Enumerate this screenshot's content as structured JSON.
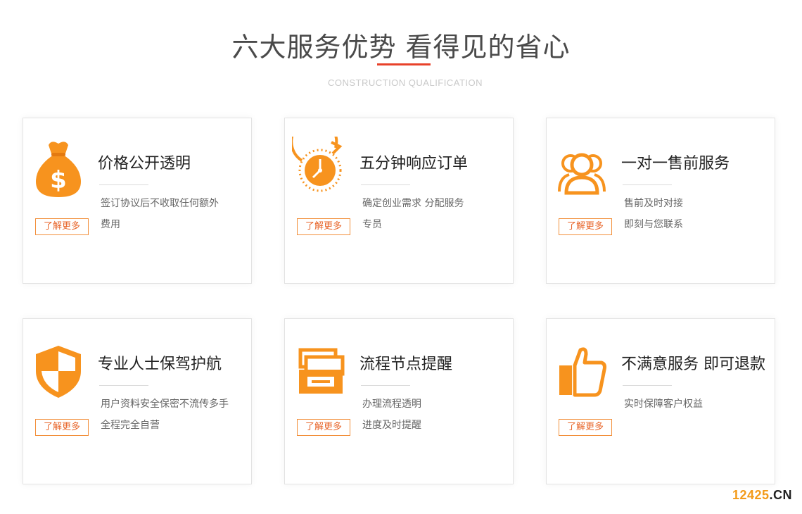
{
  "header": {
    "title": "六大服务优势 看得见的省心",
    "subtitle": "CONSTRUCTION QUALIFICATION"
  },
  "colors": {
    "accent": "#e8412a",
    "icon": "#f7931e",
    "button_border": "#f28f3a"
  },
  "cards": [
    {
      "icon": "money-bag-icon",
      "title": "价格公开透明",
      "desc_lines": [
        "签订协议后不收取任何额外",
        "费用"
      ],
      "button": "了解更多"
    },
    {
      "icon": "clock-icon",
      "title": "五分钟响应订单",
      "desc_lines": [
        "确定创业需求 分配服务",
        "专员"
      ],
      "button": "了解更多"
    },
    {
      "icon": "users-icon",
      "title": "一对一售前服务",
      "desc_lines": [
        "售前及时对接",
        "即刻与您联系"
      ],
      "button": "了解更多"
    },
    {
      "icon": "shield-icon",
      "title": "专业人士保驾护航",
      "desc_lines": [
        "用户资料安全保密不流传多手",
        "全程完全自营"
      ],
      "button": "了解更多"
    },
    {
      "icon": "folder-process-icon",
      "title": "流程节点提醒",
      "desc_lines": [
        "办理流程透明",
        "进度及时提醒"
      ],
      "button": "了解更多"
    },
    {
      "icon": "thumbs-up-icon",
      "title": "不满意服务 即可退款",
      "desc_lines": [
        "实时保障客户权益"
      ],
      "button": "了解更多"
    }
  ],
  "watermark": {
    "number": "12425",
    "suffix": ".CN"
  }
}
